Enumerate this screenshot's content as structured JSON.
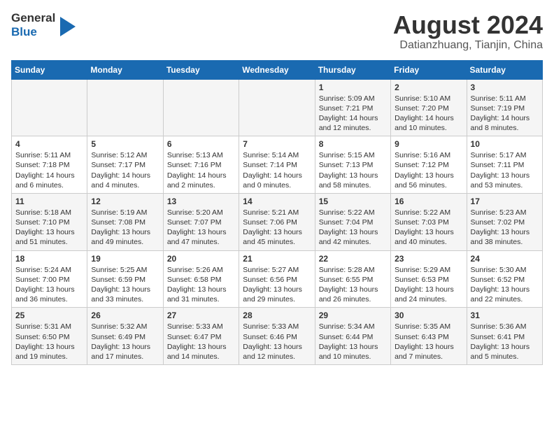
{
  "header": {
    "logo_line1": "General",
    "logo_line2": "Blue",
    "month_year": "August 2024",
    "location": "Datianzhuang, Tianjin, China"
  },
  "days_of_week": [
    "Sunday",
    "Monday",
    "Tuesday",
    "Wednesday",
    "Thursday",
    "Friday",
    "Saturday"
  ],
  "weeks": [
    [
      {
        "day": "",
        "info": ""
      },
      {
        "day": "",
        "info": ""
      },
      {
        "day": "",
        "info": ""
      },
      {
        "day": "",
        "info": ""
      },
      {
        "day": "1",
        "info": "Sunrise: 5:09 AM\nSunset: 7:21 PM\nDaylight: 14 hours\nand 12 minutes."
      },
      {
        "day": "2",
        "info": "Sunrise: 5:10 AM\nSunset: 7:20 PM\nDaylight: 14 hours\nand 10 minutes."
      },
      {
        "day": "3",
        "info": "Sunrise: 5:11 AM\nSunset: 7:19 PM\nDaylight: 14 hours\nand 8 minutes."
      }
    ],
    [
      {
        "day": "4",
        "info": "Sunrise: 5:11 AM\nSunset: 7:18 PM\nDaylight: 14 hours\nand 6 minutes."
      },
      {
        "day": "5",
        "info": "Sunrise: 5:12 AM\nSunset: 7:17 PM\nDaylight: 14 hours\nand 4 minutes."
      },
      {
        "day": "6",
        "info": "Sunrise: 5:13 AM\nSunset: 7:16 PM\nDaylight: 14 hours\nand 2 minutes."
      },
      {
        "day": "7",
        "info": "Sunrise: 5:14 AM\nSunset: 7:14 PM\nDaylight: 14 hours\nand 0 minutes."
      },
      {
        "day": "8",
        "info": "Sunrise: 5:15 AM\nSunset: 7:13 PM\nDaylight: 13 hours\nand 58 minutes."
      },
      {
        "day": "9",
        "info": "Sunrise: 5:16 AM\nSunset: 7:12 PM\nDaylight: 13 hours\nand 56 minutes."
      },
      {
        "day": "10",
        "info": "Sunrise: 5:17 AM\nSunset: 7:11 PM\nDaylight: 13 hours\nand 53 minutes."
      }
    ],
    [
      {
        "day": "11",
        "info": "Sunrise: 5:18 AM\nSunset: 7:10 PM\nDaylight: 13 hours\nand 51 minutes."
      },
      {
        "day": "12",
        "info": "Sunrise: 5:19 AM\nSunset: 7:08 PM\nDaylight: 13 hours\nand 49 minutes."
      },
      {
        "day": "13",
        "info": "Sunrise: 5:20 AM\nSunset: 7:07 PM\nDaylight: 13 hours\nand 47 minutes."
      },
      {
        "day": "14",
        "info": "Sunrise: 5:21 AM\nSunset: 7:06 PM\nDaylight: 13 hours\nand 45 minutes."
      },
      {
        "day": "15",
        "info": "Sunrise: 5:22 AM\nSunset: 7:04 PM\nDaylight: 13 hours\nand 42 minutes."
      },
      {
        "day": "16",
        "info": "Sunrise: 5:22 AM\nSunset: 7:03 PM\nDaylight: 13 hours\nand 40 minutes."
      },
      {
        "day": "17",
        "info": "Sunrise: 5:23 AM\nSunset: 7:02 PM\nDaylight: 13 hours\nand 38 minutes."
      }
    ],
    [
      {
        "day": "18",
        "info": "Sunrise: 5:24 AM\nSunset: 7:00 PM\nDaylight: 13 hours\nand 36 minutes."
      },
      {
        "day": "19",
        "info": "Sunrise: 5:25 AM\nSunset: 6:59 PM\nDaylight: 13 hours\nand 33 minutes."
      },
      {
        "day": "20",
        "info": "Sunrise: 5:26 AM\nSunset: 6:58 PM\nDaylight: 13 hours\nand 31 minutes."
      },
      {
        "day": "21",
        "info": "Sunrise: 5:27 AM\nSunset: 6:56 PM\nDaylight: 13 hours\nand 29 minutes."
      },
      {
        "day": "22",
        "info": "Sunrise: 5:28 AM\nSunset: 6:55 PM\nDaylight: 13 hours\nand 26 minutes."
      },
      {
        "day": "23",
        "info": "Sunrise: 5:29 AM\nSunset: 6:53 PM\nDaylight: 13 hours\nand 24 minutes."
      },
      {
        "day": "24",
        "info": "Sunrise: 5:30 AM\nSunset: 6:52 PM\nDaylight: 13 hours\nand 22 minutes."
      }
    ],
    [
      {
        "day": "25",
        "info": "Sunrise: 5:31 AM\nSunset: 6:50 PM\nDaylight: 13 hours\nand 19 minutes."
      },
      {
        "day": "26",
        "info": "Sunrise: 5:32 AM\nSunset: 6:49 PM\nDaylight: 13 hours\nand 17 minutes."
      },
      {
        "day": "27",
        "info": "Sunrise: 5:33 AM\nSunset: 6:47 PM\nDaylight: 13 hours\nand 14 minutes."
      },
      {
        "day": "28",
        "info": "Sunrise: 5:33 AM\nSunset: 6:46 PM\nDaylight: 13 hours\nand 12 minutes."
      },
      {
        "day": "29",
        "info": "Sunrise: 5:34 AM\nSunset: 6:44 PM\nDaylight: 13 hours\nand 10 minutes."
      },
      {
        "day": "30",
        "info": "Sunrise: 5:35 AM\nSunset: 6:43 PM\nDaylight: 13 hours\nand 7 minutes."
      },
      {
        "day": "31",
        "info": "Sunrise: 5:36 AM\nSunset: 6:41 PM\nDaylight: 13 hours\nand 5 minutes."
      }
    ]
  ]
}
